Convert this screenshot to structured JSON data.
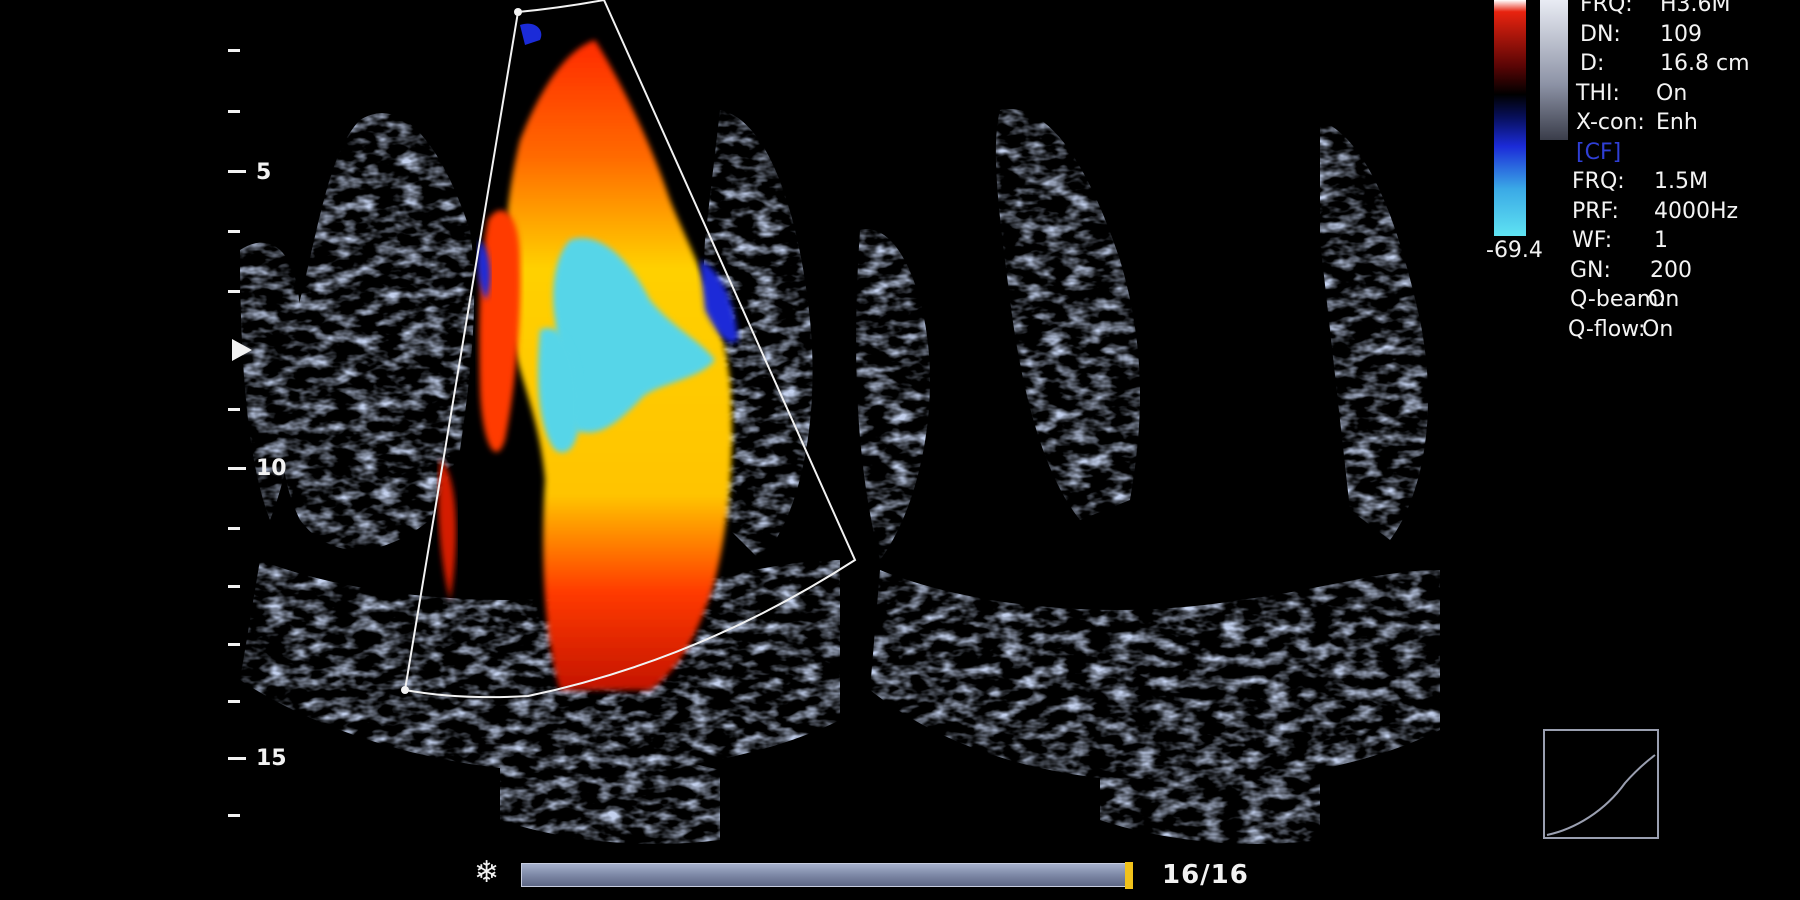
{
  "depth_scale": {
    "labels": [
      "5",
      "10",
      "15"
    ]
  },
  "color_bar": {
    "min_label": "-69.4",
    "colors": {
      "positive_top": "#ffffff",
      "positive": "#e8230f",
      "zero": "#000000",
      "negative": "#1b2bd8",
      "negative_bottom": "#5fe3f2"
    }
  },
  "params": {
    "rows": [
      {
        "key": "FRQ:",
        "value": "H3.6M"
      },
      {
        "key": "DN:",
        "value": "109"
      },
      {
        "key": "D:",
        "value": "16.8 cm"
      },
      {
        "key": "THI:",
        "value": "On"
      },
      {
        "key": "X-con:",
        "value": "Enh"
      }
    ],
    "cf_header": "[CF]",
    "cf_rows": [
      {
        "key": "FRQ:",
        "value": "1.5M"
      },
      {
        "key": "PRF:",
        "value": "4000Hz"
      },
      {
        "key": "WF:",
        "value": "1"
      },
      {
        "key": "GN:",
        "value": "200"
      },
      {
        "key": "Q-beam:",
        "value": "On"
      },
      {
        "key": "Q-flow:",
        "value": "On"
      }
    ]
  },
  "cine": {
    "counter": "16/16",
    "frame_current": 16,
    "frame_total": 16,
    "freeze_icon": "snowflake-icon"
  },
  "colors": {
    "background": "#000000",
    "tissue": "#9fb0d8",
    "doppler_hot": "#ffd400",
    "doppler_red": "#ff3a00",
    "doppler_cyan": "#56d5e8",
    "cine_handle": "#f1c21b"
  }
}
